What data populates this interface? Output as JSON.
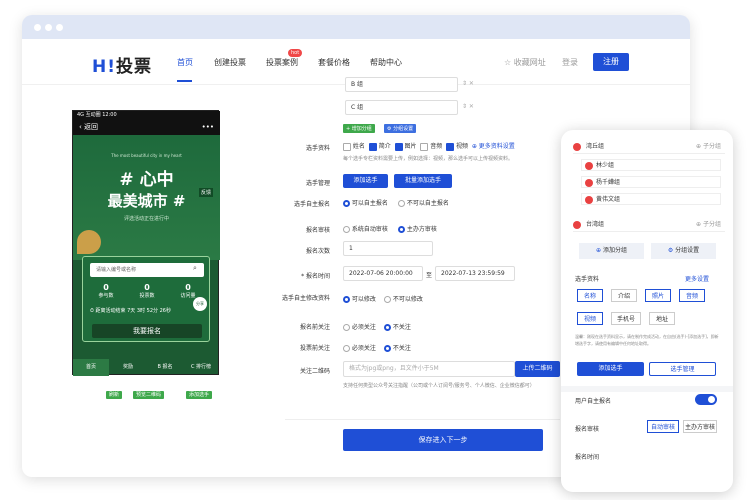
{
  "browser": {},
  "nav": {
    "logo_h": "H!",
    "logo_text": "投票",
    "items": [
      "首页",
      "创建投票",
      "投票案例",
      "套餐价格",
      "帮助中心"
    ],
    "hot": "hot",
    "favorite": "收藏网址",
    "login": "登录",
    "register": "注册"
  },
  "phone": {
    "status": "4G  互动圈        12:00",
    "back": "返回",
    "slogan": "The most beautiful city in my heart",
    "title1": "# 心中",
    "title2": "最美城市 #",
    "subtitle": "评选活动正在进行中",
    "feedback": "反馈",
    "share": "分享",
    "search_placeholder": "请输入编号或名称",
    "stats": [
      {
        "num": "0",
        "label": "参与数"
      },
      {
        "num": "0",
        "label": "投票数"
      },
      {
        "num": "0",
        "label": "访问量"
      }
    ],
    "countdown": "距离活动结束 7天 3时 52分 26秒",
    "cta": "我要报名",
    "tabs": [
      "首页",
      "奖励",
      "B 报名",
      "C 排行榜"
    ],
    "mini_buttons": [
      "刷新",
      "预览二维码",
      "添加选手"
    ]
  },
  "form": {
    "groups": [
      "B 组",
      "C 组"
    ],
    "add_group": "增加分组",
    "group_settings": "分组设置",
    "contest_info_label": "选手资料",
    "fields": [
      {
        "name": "姓名",
        "on": false
      },
      {
        "name": "简介",
        "on": true
      },
      {
        "name": "图片",
        "on": true
      },
      {
        "name": "音频",
        "on": false
      },
      {
        "name": "视频",
        "on": true
      }
    ],
    "more_fields": "更多资料设置",
    "fields_hint": "每个选手专栏资料需要上传，例如选择：视频，那么选手可以上传视频资料。",
    "manage_label": "选手管理",
    "add_player": "添加选手",
    "batch_add": "批量添加选手",
    "self_reg_label": "选手自主报名",
    "self_reg_opts": [
      "可以自主报名",
      "不可以自主报名"
    ],
    "review_label": "报名审核",
    "review_opts": [
      "系统自动审核",
      "主办方审核"
    ],
    "times_label": "报名次数",
    "times_value": "1",
    "time_label": "* 报名时间",
    "start": "2022-07-06 20:00:00",
    "to": "至",
    "end": "2022-07-13 23:59:59",
    "edit_label": "选手自主修改资料",
    "edit_opts": [
      "可以修改",
      "不可以修改"
    ],
    "follow_label": "报名前关注",
    "follow_opts": [
      "必须关注",
      "不关注"
    ],
    "vote_follow_label": "投票前关注",
    "vote_follow_opts": [
      "必须关注",
      "不关注"
    ],
    "qr_label": "关注二维码",
    "qr_placeholder": "格式为jpg或png，且文件小于5M",
    "qr_upload": "上传二维码",
    "qr_hint": "支持任何类型公众号关注指醒（公司或个人订阅号/服务号、个人微信、企业微信都可）",
    "save": "保存进入下一步"
  },
  "mobile": {
    "group1": "湾丘组",
    "child": "子分组",
    "members": [
      "林少组",
      "杨千嬅组",
      "黄伟文组"
    ],
    "group2": "台湾组",
    "child2": "子分组",
    "add_group": "添加分组",
    "group_settings": "分组设置",
    "info": "选手资料",
    "more": "更多设置",
    "tags_row1": [
      "名称",
      "介绍",
      "照片",
      "音频"
    ],
    "tags_row2": [
      "视频",
      "手机号",
      "地址"
    ],
    "hint": "温馨：刚现在选手资料显示，请在制作完成活动，在自由(选手)-[添加选手]，即新增选手字，请使用有编辑中任何地址取得。",
    "add_player": "添加选手",
    "manage_player": "选手管理",
    "self_reg": "用户自主报名",
    "review": "报名审核",
    "review_opts": [
      "自动审核",
      "主办方审核"
    ],
    "time": "报名时间"
  }
}
